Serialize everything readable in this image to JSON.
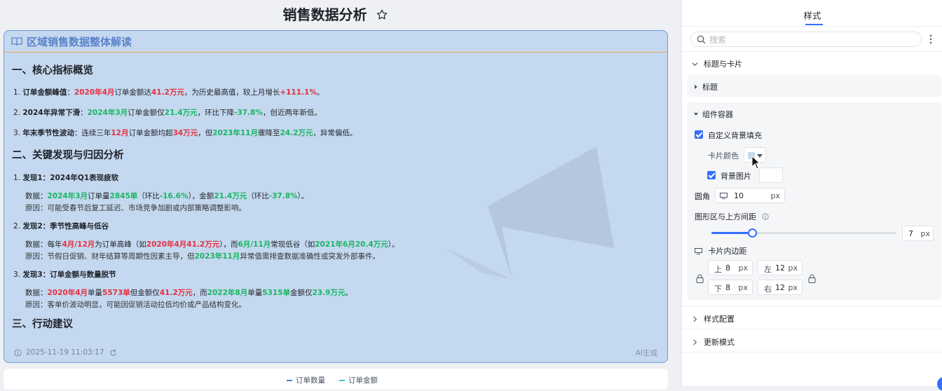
{
  "page": {
    "title": "销售数据分析"
  },
  "card": {
    "title": "区域销售数据整体解读",
    "timestamp": "2025-11-19 11:03:17",
    "ai_tag": "AI生成",
    "s1": "一、核心指标概览",
    "s1_items": [
      {
        "num": "1.",
        "a": "订单金额峰值",
        "b": "：",
        "c": "2020年4月",
        "d": "订单金额达",
        "e": "41.2万元",
        "f": "，为历史最高值，较上月增长",
        "g": "+111.1%",
        "h": "。"
      },
      {
        "num": "2.",
        "a": "2024年异常下滑",
        "b": "：",
        "c": "2024年3月",
        "d": "订单金额仅",
        "e": "21.4万元",
        "f": "，环比下降",
        "g": "-37.8%",
        "h": "，创近两年新低。"
      },
      {
        "num": "3.",
        "a": "年末季节性波动",
        "b": "：连续三年",
        "c": "12月",
        "d": "订单金额均超",
        "e": "34万元",
        "f": "，但",
        "g": "2023年11月",
        "h": "骤降至",
        "i": "24.2万元",
        "j": "，异常偏低。"
      }
    ],
    "s2": "二、关键发现与归因分析",
    "f1": {
      "title_num": "1.",
      "title_a": "发现1：",
      "title_b": "2024年Q1表现疲软",
      "d_label": "数据：",
      "d1": "2024年3月",
      "d2": "订单量",
      "d3": "2845单",
      "d4": "（环比",
      "d5": "-16.6%",
      "d6": "），金额",
      "d7": "21.4万元",
      "d8": "（环比",
      "d9": "-37.8%",
      "d10": "）。",
      "reason": "原因：可能受春节后复工延迟、市场竞争加剧或内部策略调整影响。"
    },
    "f2": {
      "title_num": "2.",
      "title_a": "发现2：季节性高峰与低谷",
      "d_label": "数据：每年",
      "d1": "4月/12月",
      "d2": "为订单高峰（如",
      "d3": "2020年4月41.2万元",
      "d4": "），而",
      "d5": "6月/11月",
      "d6": "常现低谷（如",
      "d7": "2021年6月20.4万元",
      "d8": "）。",
      "reason_a": "原因：节假日促销、财年结算等周期性因素主导，但",
      "reason_b": "2023年11月",
      "reason_c": "异常值需排查数据准确性或突发外部事件。"
    },
    "f3": {
      "title_num": "3.",
      "title_a": "发现3：订单金额与数量脱节",
      "d_label": "数据：",
      "d1": "2020年4月",
      "d2": "单量",
      "d3": "5573单",
      "d4": "但金额仅",
      "d5": "41.2万元",
      "d6": "，而",
      "d7": "2022年8月",
      "d8": "单量",
      "d9": "5315单",
      "d10": "金额仅",
      "d11": "23.9万元",
      "d12": "。",
      "reason": "原因：客单价波动明显，可能因促销活动拉低均价或产品结构变化。"
    },
    "s3": "三、行动建议"
  },
  "legend": [
    {
      "label": "订单数量",
      "color": "#4a7fe0"
    },
    {
      "label": "订单金额",
      "color": "#3cc9c0"
    }
  ],
  "panel": {
    "tab": "样式",
    "search_placeholder": "搜索",
    "sec_title_card": "标题与卡片",
    "sub_title": "标题",
    "sub_container": "组件容器",
    "custom_bg": "自定义背景填充",
    "card_color": "卡片颜色",
    "bg_image": "背景图片",
    "radius_label": "圆角",
    "radius_value": "10",
    "unit_px": "px",
    "gap_label": "图形区与上方间距",
    "gap_value": "7",
    "gap_fraction": 0.22,
    "padding_label": "卡片内边距",
    "pad": [
      {
        "label": "上",
        "value": "8"
      },
      {
        "label": "左",
        "value": "12"
      },
      {
        "label": "下",
        "value": "8"
      },
      {
        "label": "右",
        "value": "12"
      }
    ],
    "sec_style": "样式配置",
    "sec_update": "更新模式",
    "accent": "#3370ff"
  }
}
